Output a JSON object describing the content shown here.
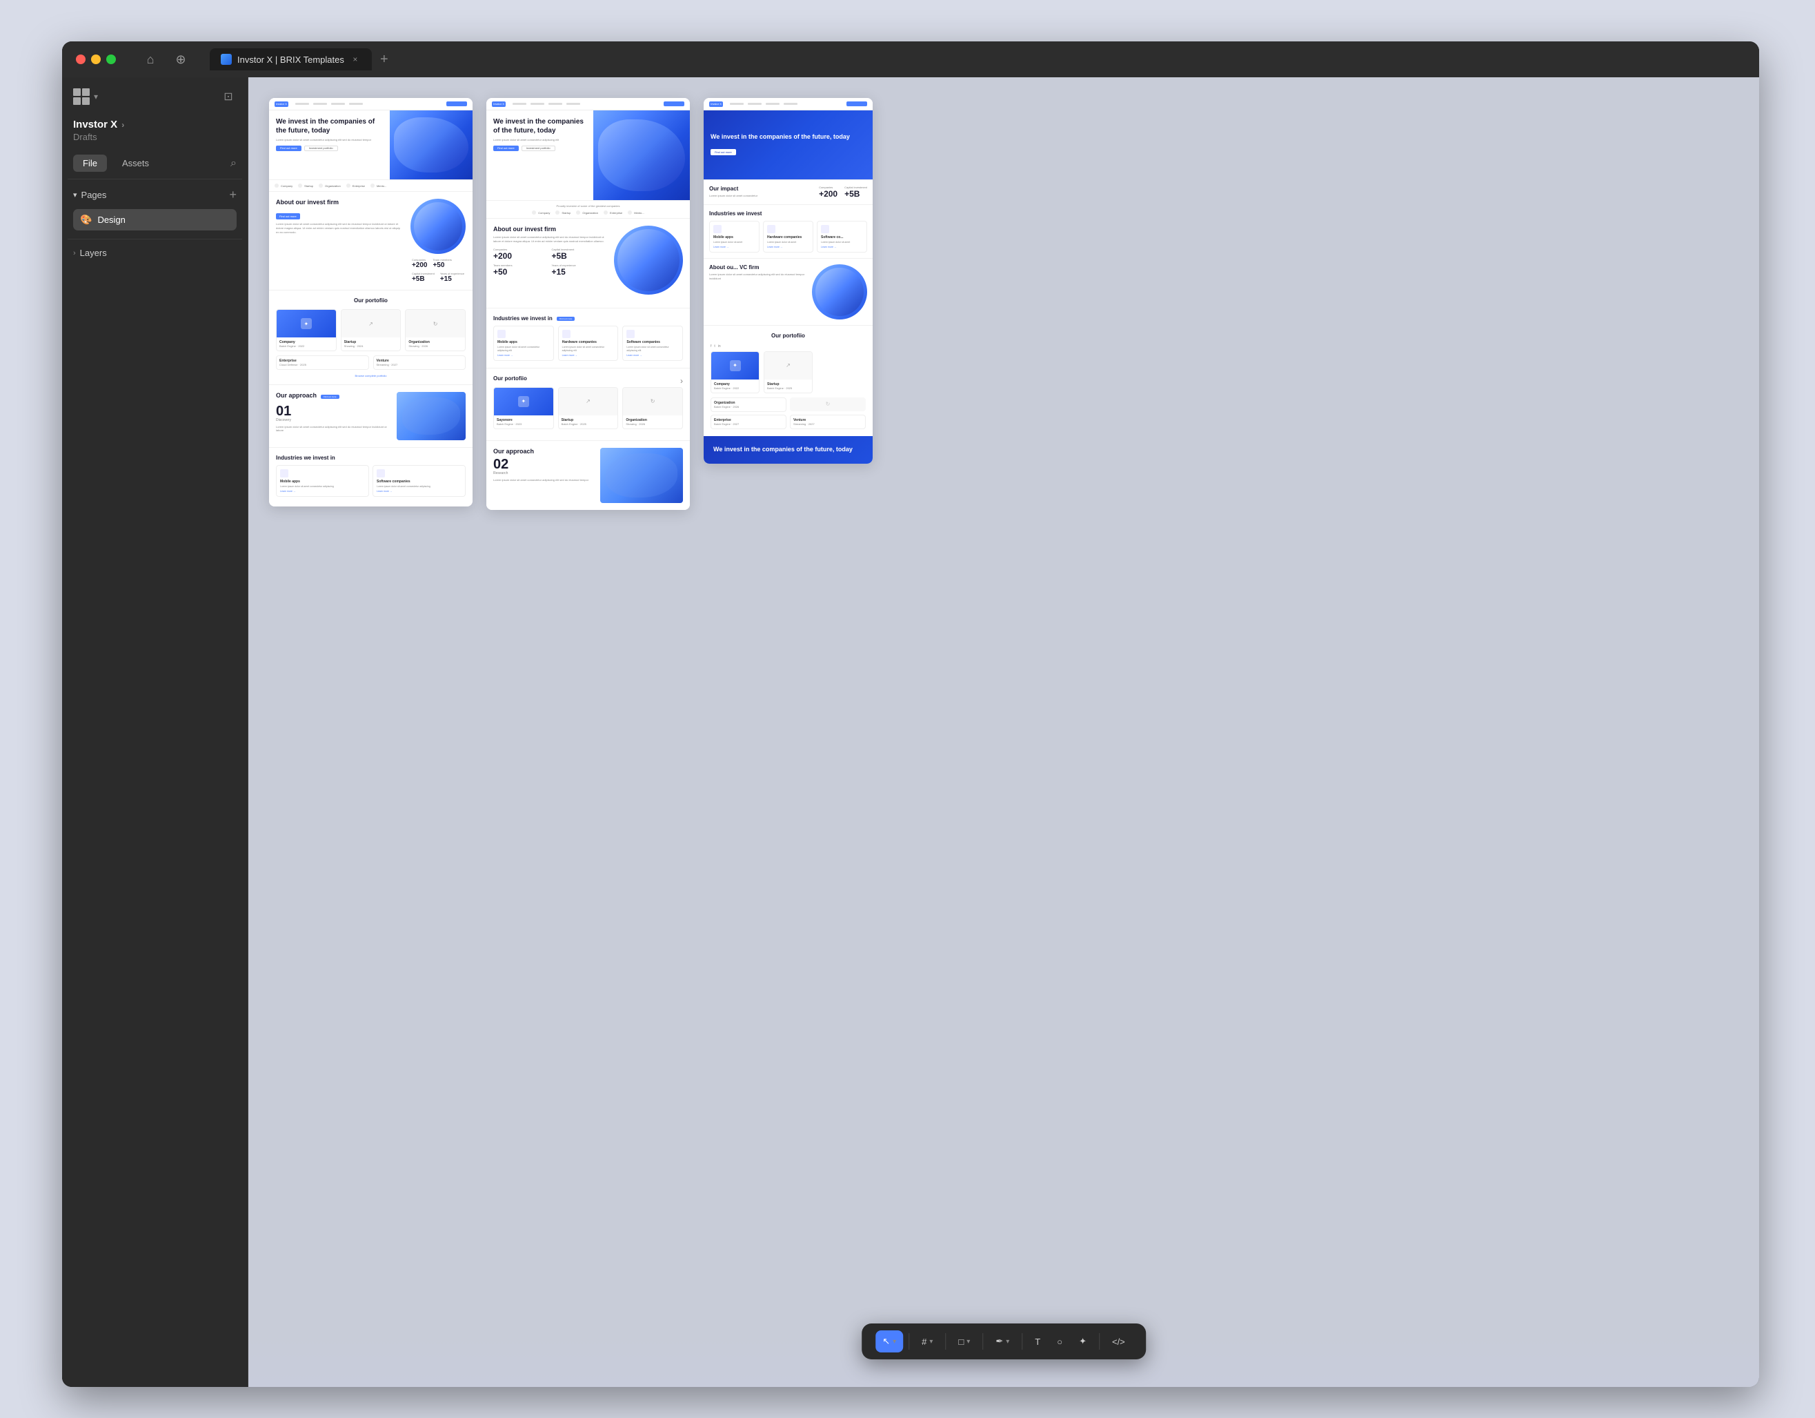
{
  "browser": {
    "title": "Invstor X | BRIX Templates",
    "tab_close": "×",
    "tab_new": "+"
  },
  "sidebar": {
    "logo_label": "Brix",
    "project_name": "Invstor X",
    "project_chevron": "›",
    "project_sub": "Drafts",
    "file_btn": "File",
    "assets_btn": "Assets",
    "pages_section": "Pages",
    "pages_add": "+",
    "active_page_emoji": "🎨",
    "active_page_name": "Design",
    "layers_label": "Layers"
  },
  "toolbar": {
    "select_tool": "↖",
    "frame_tool": "#",
    "rect_tool": "□",
    "pen_tool": "✒",
    "text_tool": "T",
    "comment_tool": "○",
    "ai_tool": "✦",
    "code_tool": "</>",
    "chevron": "▾"
  },
  "canvas": {
    "pages": [
      {
        "id": "page1",
        "hero_title": "We invest in the companies of the future, today",
        "hero_subtitle": "Lorem ipsum dolor sit amet consectetur adipiscing elit",
        "btn_primary": "Find out more",
        "btn_secondary": "Investment portfolio",
        "trust_items": [
          "Company",
          "Startup",
          "Organization",
          "Enterprise",
          "Mento..."
        ],
        "about_title": "About our invest firm",
        "about_tag": "Find out more",
        "stats": [
          {
            "label": "Companies",
            "value": "+200"
          },
          {
            "label": "Team members",
            "value": "+50"
          },
          {
            "label": "Capital investment",
            "value": "+5B"
          },
          {
            "label": "Years of experience",
            "value": "+15"
          }
        ],
        "portfolio_title": "Our portofiio",
        "portfolio_items": [
          {
            "name": "Company",
            "date": "Batch Engine · 2022"
          },
          {
            "name": "Startup",
            "date": "Showing · 2024"
          },
          {
            "name": "Organization",
            "date": "Showing · 2026"
          },
          {
            "name": "Enterprise",
            "date": "Cloud Defense · 2025"
          },
          {
            "name": "Venture",
            "date": "Streaming · 2027"
          }
        ],
        "portfolio_link": "Browse complete portfolio",
        "approach_title": "Our approach",
        "approach_tag": "Find out more",
        "approach_step": "01",
        "approach_step_label": "Discovery",
        "industries_title": "Industries we invest in"
      },
      {
        "id": "page2",
        "hero_title": "We invest in the companies of the future, today",
        "portfolio_title": "Our portofiio",
        "about_title": "About our invest firm",
        "stats": [
          {
            "label": "Companies",
            "value": "+200"
          },
          {
            "label": "Capital investment",
            "value": "+5B"
          },
          {
            "label": "Team members",
            "value": "+50"
          },
          {
            "label": "Years of experience",
            "value": "+15"
          }
        ],
        "industries_title": "Industries we invest in",
        "approach_step": "02 Research",
        "approach_title": "Our approach",
        "trust_label": "Proudly investee of some of the greatest companies"
      },
      {
        "id": "page3",
        "hero_title": "We invest in the companies of the future, today",
        "impact_title": "Our impact",
        "impact_stats": [
          {
            "label": "Companies",
            "value": "+200"
          },
          {
            "label": "Capital Investment",
            "value": "+5B"
          }
        ],
        "industries_title": "Industries we invest",
        "industries": [
          "Mobile apps",
          "Hardware companies",
          "Software co..."
        ],
        "about_title": "About our VC firm",
        "portfolio_title": "Our portofiio",
        "portfolio_items": [
          "Company",
          "Startup",
          "Organization",
          "Enterprise",
          "Venture"
        ],
        "bottom_text": "We invest in the companies of the future, today"
      }
    ]
  }
}
